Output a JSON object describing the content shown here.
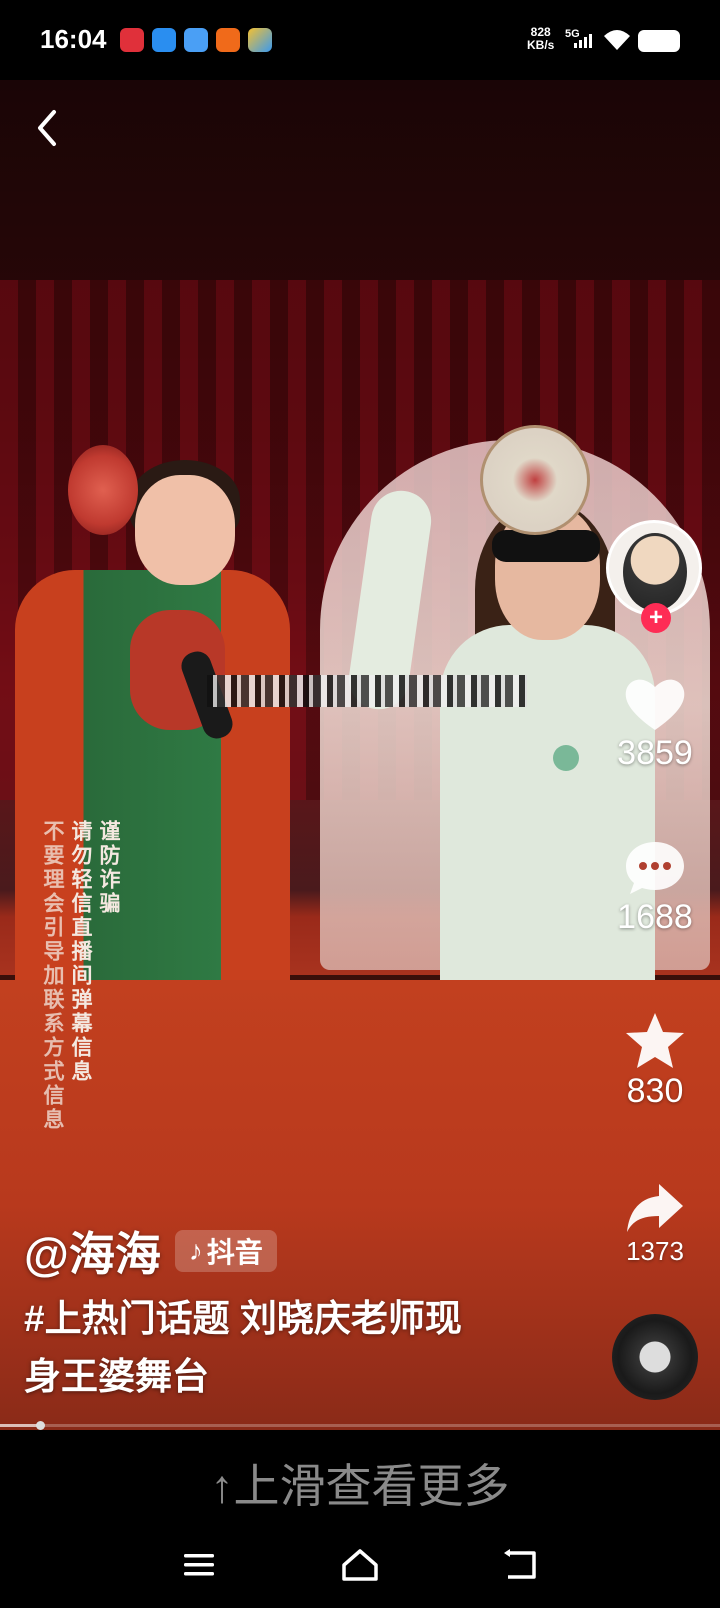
{
  "status_bar": {
    "time": "16:04",
    "net_speed_value": "828",
    "net_speed_unit": "KB/s",
    "network": "5G",
    "notification_icons": [
      "app-icon-red",
      "app-icon-blue",
      "app-icon-blue-light",
      "app-icon-orange",
      "app-icon-multicolor"
    ]
  },
  "video": {
    "disclaimer_columns": [
      "谨防诈骗",
      "请勿轻信直播间弹幕信息",
      "不要理会引导加联系方式信息"
    ]
  },
  "actions": {
    "like_count": "3859",
    "comment_count": "1688",
    "favorite_count": "830",
    "share_count": "1373"
  },
  "caption": {
    "author": "@海海",
    "platform": "抖音",
    "text": "#上热门话题 刘晓庆老师现身王婆舞台"
  },
  "progress": {
    "fraction": 0.055
  },
  "bottom": {
    "swipe_hint": "↑上滑查看更多"
  },
  "colors": {
    "follow_accent": "#fe2c55",
    "stage_red": "#b8391d",
    "hint_gray": "#8a8a8a"
  }
}
